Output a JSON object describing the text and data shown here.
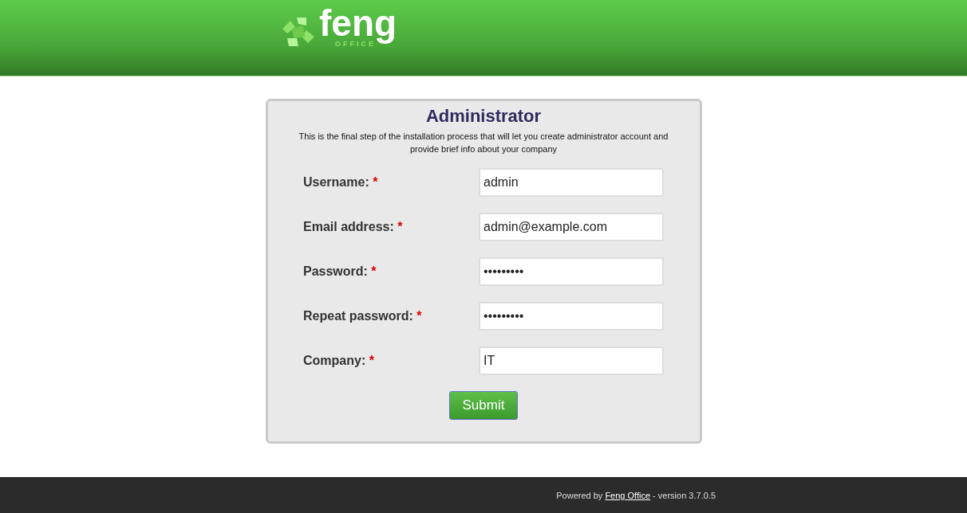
{
  "logo": {
    "name": "feng",
    "subtitle": "OFFICE"
  },
  "form": {
    "title": "Administrator",
    "description": "This is the final step of the installation process that will let you create administrator account and provide brief info about your company",
    "fields": [
      {
        "label": "Username:",
        "required_mark": "*",
        "value": "admin"
      },
      {
        "label": "Email address:",
        "required_mark": "*",
        "value": "admin@example.com"
      },
      {
        "label": "Password:",
        "required_mark": "*",
        "value": "•••••••••"
      },
      {
        "label": "Repeat password:",
        "required_mark": "*",
        "value": "•••••••••"
      },
      {
        "label": "Company:",
        "required_mark": "*",
        "value": "IT"
      }
    ],
    "submit": "Submit"
  },
  "footer": {
    "prefix": "Powered by",
    "link": "Feng Office",
    "suffix": "- version 3.7.0.5"
  }
}
